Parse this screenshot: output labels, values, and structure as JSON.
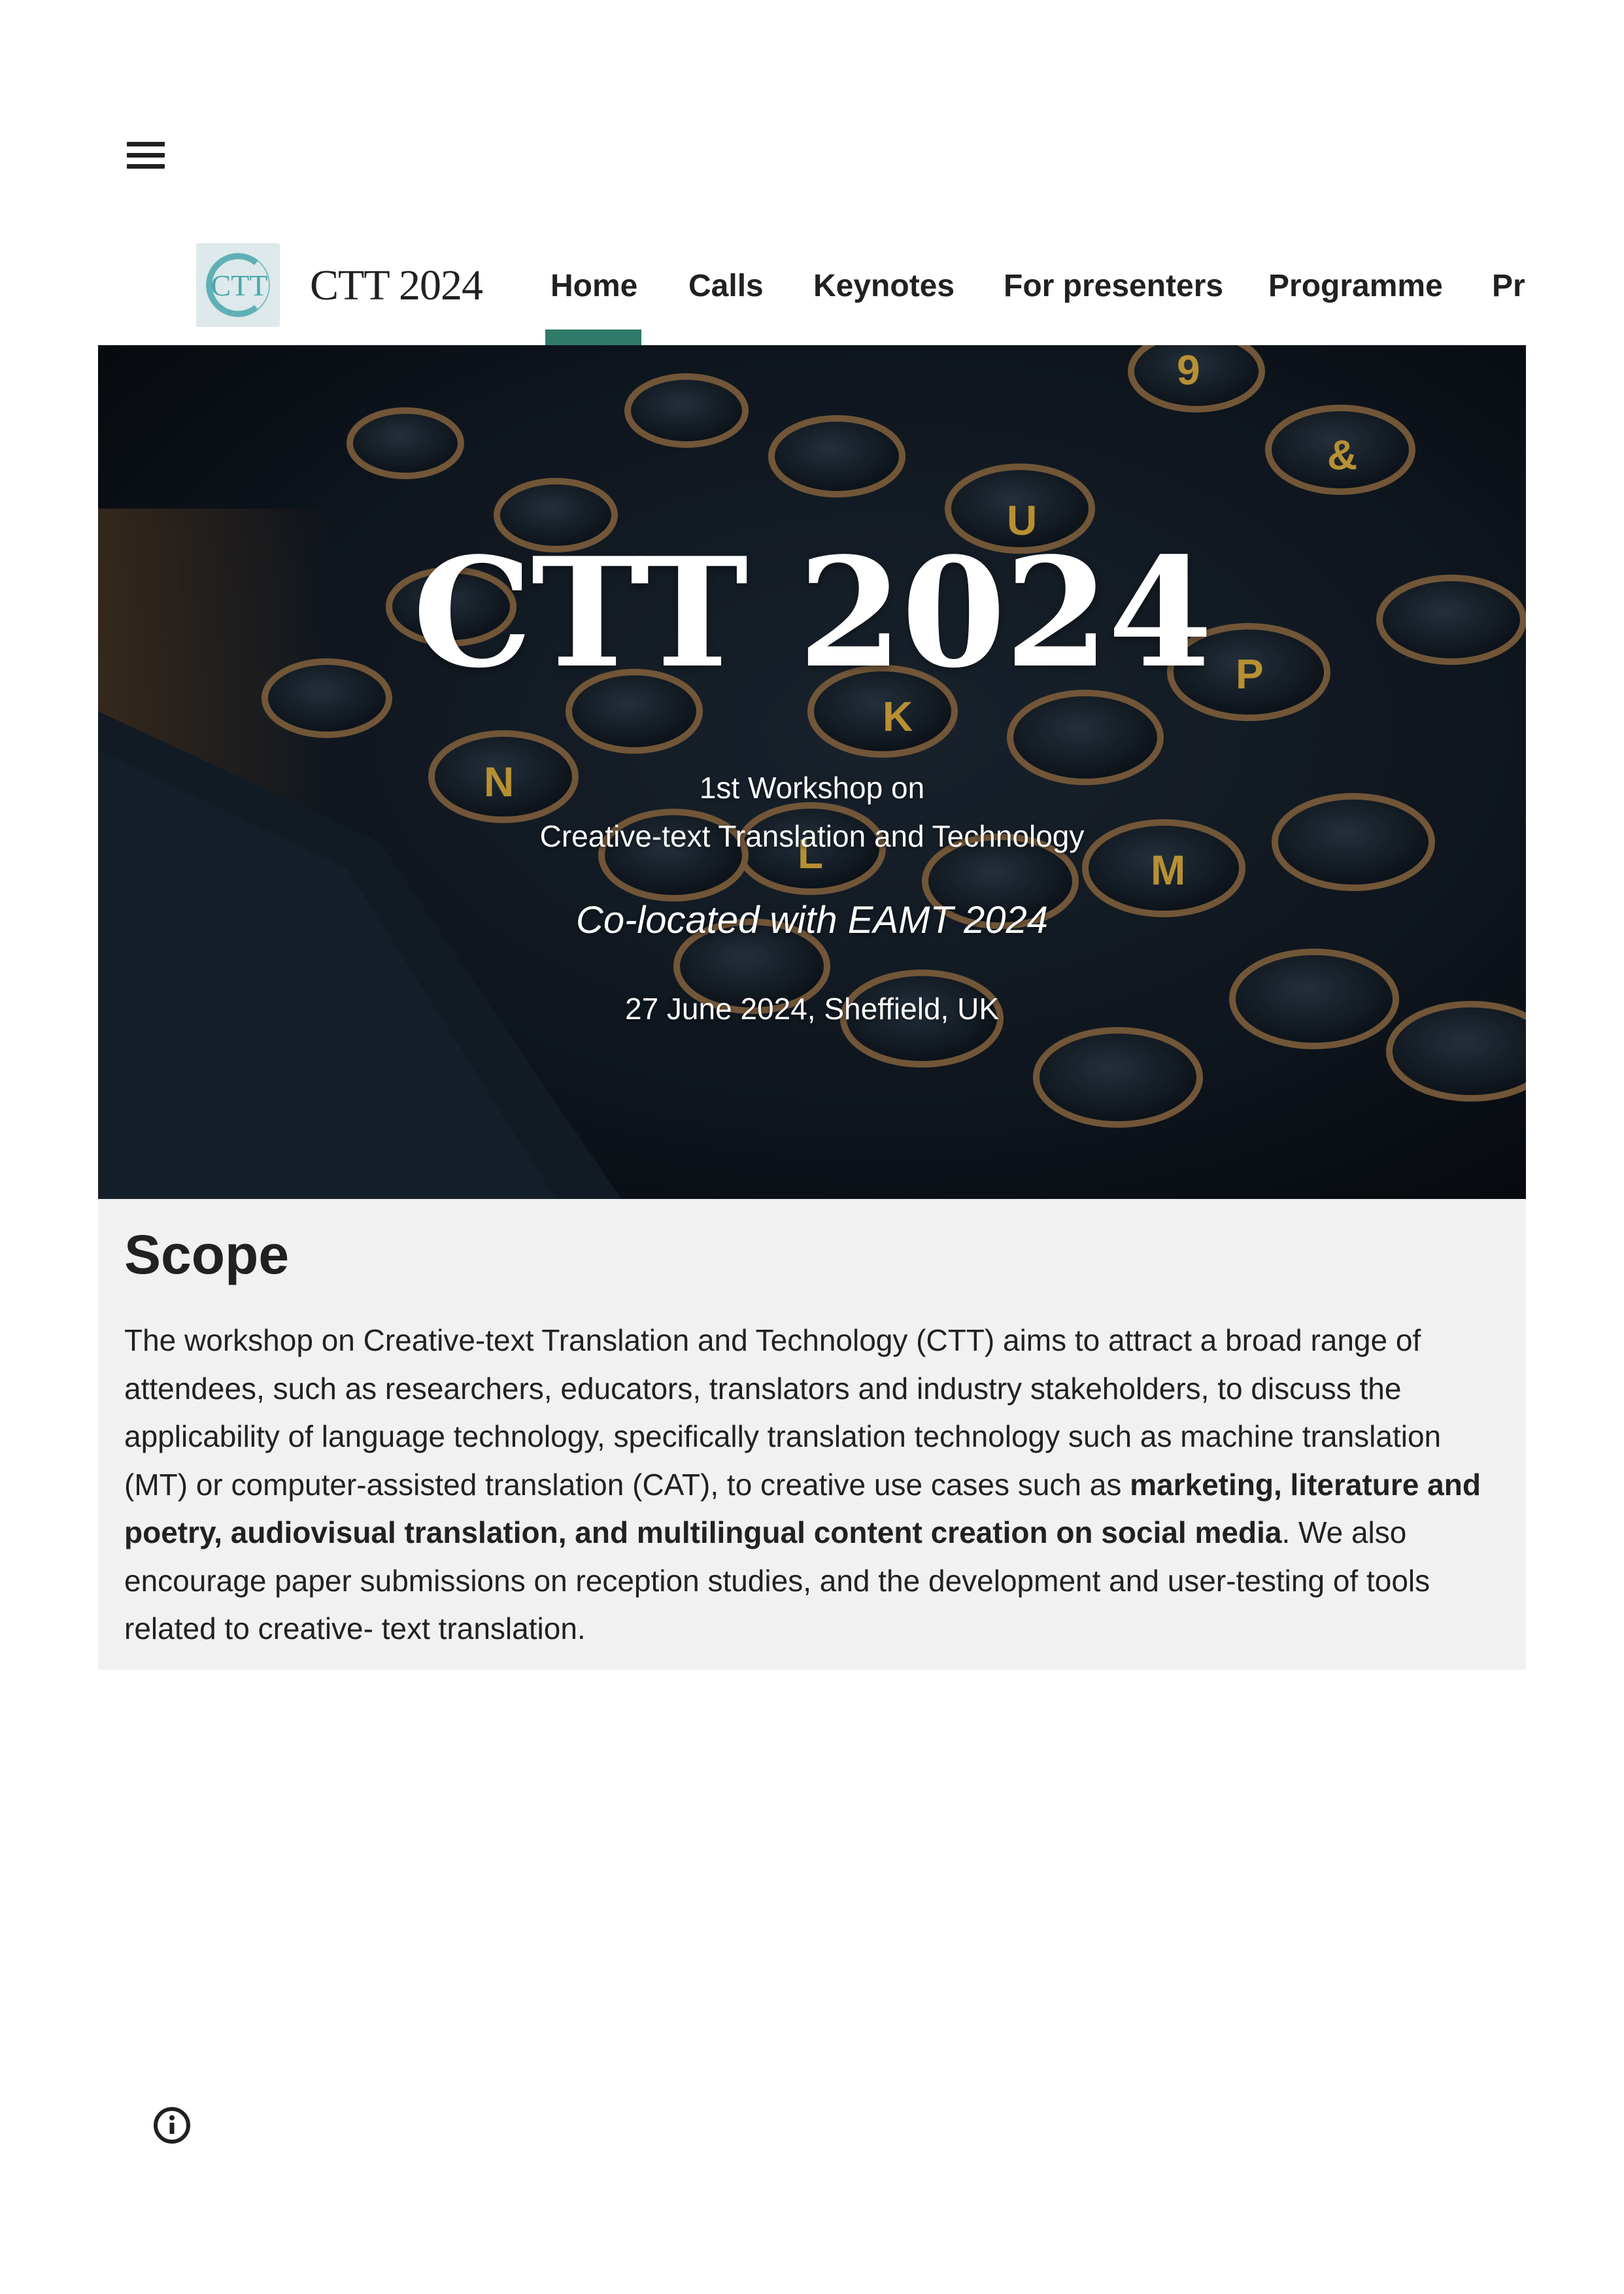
{
  "header": {
    "menu_icon": "hamburger-menu-icon",
    "site_title": "CTT 2024",
    "logo_icon": "ctt-logo-icon",
    "logo_text": "CTT"
  },
  "nav": {
    "items": [
      {
        "label": "Home",
        "active": true
      },
      {
        "label": "Calls",
        "active": false
      },
      {
        "label": "Keynotes",
        "active": false
      },
      {
        "label": "For presenters",
        "active": false
      },
      {
        "label": "Programme",
        "active": false
      },
      {
        "label": "Pr",
        "active": false
      }
    ],
    "active_color": "#2f7a68"
  },
  "hero": {
    "title": "CTT 2024",
    "subtitle_line1": "1st Workshop on",
    "subtitle_line2": "Creative-text Translation and Technology",
    "colocated": "Co-located with EAMT 2024",
    "date_location": "27 June 2024, Sheffield, UK",
    "background": "typewriter-keys-image"
  },
  "scope": {
    "heading": "Scope",
    "body_part1": "The workshop on Creative-text Translation and Technology (CTT) aims to attract a broad range of attendees, such as researchers, educators, translators and industry stakeholders, to discuss the applicability of language technology, specifically translation technology such as machine translation (MT) or computer-assisted translation (CAT), to creative use cases such as ",
    "body_bold": "marketing, literature and poetry, audiovisual translation, and multilingual content creation on social media",
    "body_part2": ". We also encourage paper submissions on reception studies, and the development and user-testing of tools related to creative- text translation."
  },
  "footer": {
    "info_icon": "info-icon"
  },
  "colors": {
    "background": "#ffffff",
    "scope_background": "#f1f1f1",
    "text": "#212121"
  }
}
